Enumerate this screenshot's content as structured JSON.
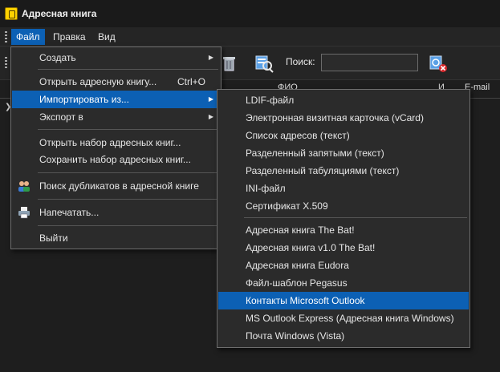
{
  "window": {
    "title": "Адресная книга"
  },
  "menubar": {
    "items": [
      "Файл",
      "Правка",
      "Вид"
    ]
  },
  "toolbar": {
    "search_label": "Поиск:",
    "search_value": ""
  },
  "columns": {
    "name": "ФИО",
    "email": "E-mail",
    "short": "И"
  },
  "file_menu": {
    "create": "Создать",
    "open": "Открыть адресную книгу...",
    "open_shortcut": "Ctrl+O",
    "import": "Импортировать из...",
    "export": "Экспорт в",
    "open_set": "Открыть набор адресных книг...",
    "save_set": "Сохранить набор адресных книг...",
    "find_duplicates": "Поиск дубликатов в адресной книге",
    "print": "Напечатать...",
    "exit": "Выйти"
  },
  "import_menu": {
    "items": [
      "LDIF-файл",
      "Электронная визитная карточка (vCard)",
      "Список адресов (текст)",
      "Разделенный запятыми (текст)",
      "Разделенный табуляциями (текст)",
      "INI-файл",
      "Сертификат X.509",
      "Адресная книга The Bat!",
      "Адресная книга v1.0 The Bat!",
      "Адресная книга Eudora",
      "Файл-шаблон Pegasus",
      "Контакты Microsoft Outlook",
      "MS Outlook Express (Адресная книга Windows)",
      "Почта Windows (Vista)"
    ],
    "highlighted_index": 11
  },
  "colors": {
    "highlight": "#0c60b4",
    "menu_bg": "#2b2b2b",
    "app_bg": "#1b1b1b"
  }
}
